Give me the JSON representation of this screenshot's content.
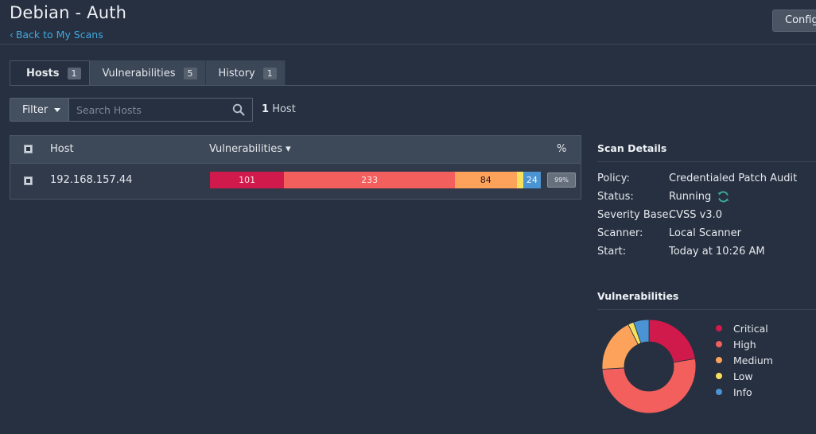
{
  "header": {
    "title": "Debian - Auth",
    "back_link": "Back to My Scans",
    "config_button": "Config"
  },
  "tabs": [
    {
      "label": "Hosts",
      "count": "1",
      "active": true
    },
    {
      "label": "Vulnerabilities",
      "count": "5",
      "active": false
    },
    {
      "label": "History",
      "count": "1",
      "active": false
    }
  ],
  "filter": {
    "label": "Filter",
    "search_placeholder": "Search Hosts",
    "host_count_number": "1",
    "host_count_label": "Host"
  },
  "table": {
    "columns": {
      "host": "Host",
      "vulnerabilities": "Vulnerabilities ▾",
      "percent": "%"
    },
    "rows": [
      {
        "host": "192.168.157.44",
        "critical": 101,
        "high": 233,
        "medium": 84,
        "low": 9,
        "info": 24,
        "critical_label": "101",
        "high_label": "233",
        "medium_label": "84",
        "low_label": "",
        "info_label": "24",
        "percent": "99%"
      }
    ]
  },
  "scan_details": {
    "title": "Scan Details",
    "rows": [
      {
        "label": "Policy:",
        "value": "Credentialed Patch Audit"
      },
      {
        "label": "Status:",
        "value": "Running"
      },
      {
        "label": "Severity Base:",
        "value": "CVSS v3.0"
      },
      {
        "label": "Scanner:",
        "value": "Local Scanner"
      },
      {
        "label": "Start:",
        "value": "Today at 10:26 AM"
      }
    ]
  },
  "vulnerabilities_chart": {
    "title": "Vulnerabilities",
    "legend": [
      "Critical",
      "High",
      "Medium",
      "Low",
      "Info"
    ]
  },
  "colors": {
    "critical": "#d01a4b",
    "high": "#f25f5c",
    "medium": "#fca25a",
    "low": "#f7e15c",
    "info": "#4b94d3",
    "accent": "#3fa9e0"
  },
  "chart_data": {
    "type": "pie",
    "categories": [
      "Critical",
      "High",
      "Medium",
      "Low",
      "Info"
    ],
    "values": [
      101,
      233,
      84,
      9,
      24
    ],
    "title": "Vulnerabilities",
    "legend": "right"
  }
}
